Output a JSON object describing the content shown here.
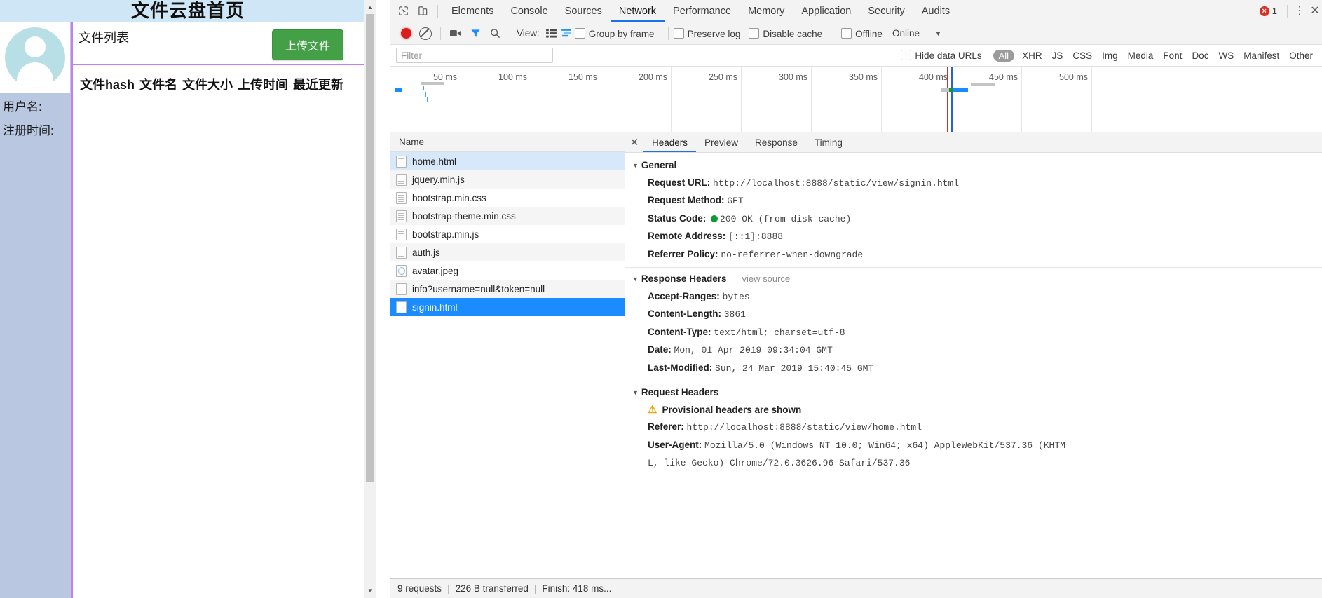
{
  "page": {
    "title": "文件云盘首页",
    "list_title": "文件列表",
    "upload_button": "上传文件",
    "sidebar": {
      "username_label": "用户名:",
      "register_time_label": "注册时间:"
    },
    "table_headers": [
      "文件hash",
      "文件名",
      "文件大小",
      "上传时间",
      "最近更新"
    ]
  },
  "devtools": {
    "tabs": [
      {
        "label": "Elements",
        "active": false
      },
      {
        "label": "Console",
        "active": false
      },
      {
        "label": "Sources",
        "active": false
      },
      {
        "label": "Network",
        "active": true
      },
      {
        "label": "Performance",
        "active": false
      },
      {
        "label": "Memory",
        "active": false
      },
      {
        "label": "Application",
        "active": false
      },
      {
        "label": "Security",
        "active": false
      },
      {
        "label": "Audits",
        "active": false
      }
    ],
    "error_count": "1",
    "toolbar": {
      "view_label": "View:",
      "group_by_frame": "Group by frame",
      "preserve_log": "Preserve log",
      "disable_cache": "Disable cache",
      "offline": "Offline",
      "throttle_value": "Online"
    },
    "filter": {
      "placeholder": "Filter",
      "hide_data_urls": "Hide data URLs",
      "types": [
        "All",
        "XHR",
        "JS",
        "CSS",
        "Img",
        "Media",
        "Font",
        "Doc",
        "WS",
        "Manifest",
        "Other"
      ]
    },
    "timeline": {
      "ticks": [
        "50 ms",
        "100 ms",
        "150 ms",
        "200 ms",
        "250 ms",
        "300 ms",
        "350 ms",
        "400 ms",
        "450 ms",
        "500 ms"
      ]
    },
    "requests": {
      "column_header": "Name",
      "rows": [
        {
          "name": "home.html",
          "icon": "document-icon",
          "state": "hovered"
        },
        {
          "name": "jquery.min.js",
          "icon": "document-icon",
          "state": "normal"
        },
        {
          "name": "bootstrap.min.css",
          "icon": "document-icon",
          "state": "normal"
        },
        {
          "name": "bootstrap-theme.min.css",
          "icon": "document-icon",
          "state": "normal"
        },
        {
          "name": "bootstrap.min.js",
          "icon": "document-icon",
          "state": "normal"
        },
        {
          "name": "auth.js",
          "icon": "document-icon",
          "state": "normal"
        },
        {
          "name": "avatar.jpeg",
          "icon": "image-icon",
          "state": "normal"
        },
        {
          "name": "info?username=null&token=null",
          "icon": "blank-icon",
          "state": "normal"
        },
        {
          "name": "signin.html",
          "icon": "blank-icon",
          "state": "selected"
        }
      ]
    },
    "detail": {
      "tabs": [
        {
          "label": "Headers",
          "active": true
        },
        {
          "label": "Preview",
          "active": false
        },
        {
          "label": "Response",
          "active": false
        },
        {
          "label": "Timing",
          "active": false
        }
      ],
      "general": {
        "title": "General",
        "items": [
          {
            "name": "Request URL:",
            "value": "http://localhost:8888/static/view/signin.html"
          },
          {
            "name": "Request Method:",
            "value": "GET"
          },
          {
            "name": "Status Code:",
            "value": "200 OK (from disk cache)",
            "dot": "#0d9b35"
          },
          {
            "name": "Remote Address:",
            "value": "[::1]:8888"
          },
          {
            "name": "Referrer Policy:",
            "value": "no-referrer-when-downgrade"
          }
        ]
      },
      "response_headers": {
        "title": "Response Headers",
        "view_source": "view source",
        "items": [
          {
            "name": "Accept-Ranges:",
            "value": "bytes"
          },
          {
            "name": "Content-Length:",
            "value": "3861"
          },
          {
            "name": "Content-Type:",
            "value": "text/html; charset=utf-8"
          },
          {
            "name": "Date:",
            "value": "Mon, 01 Apr 2019 09:34:04 GMT"
          },
          {
            "name": "Last-Modified:",
            "value": "Sun, 24 Mar 2019 15:40:45 GMT"
          }
        ]
      },
      "request_headers": {
        "title": "Request Headers",
        "warning": "Provisional headers are shown",
        "items": [
          {
            "name": "Referer:",
            "value": "http://localhost:8888/static/view/home.html"
          },
          {
            "name": "User-Agent:",
            "value": "Mozilla/5.0 (Windows NT 10.0; Win64; x64) AppleWebKit/537.36 (KHTM"
          },
          {
            "name": "",
            "value": "L, like Gecko) Chrome/72.0.3626.96 Safari/537.36"
          }
        ]
      }
    },
    "status_bar": {
      "requests": "9 requests",
      "transferred": "226 B transferred",
      "finish": "Finish: 418 ms..."
    }
  }
}
